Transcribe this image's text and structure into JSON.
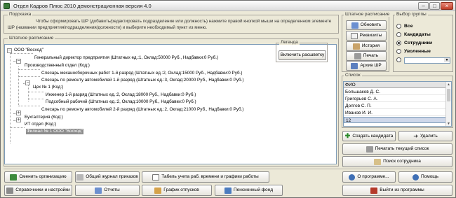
{
  "window": {
    "title": "Отдел Кадров Плюс 2010 демонстрационная версия 4.0",
    "minimize": "–",
    "maximize": "□",
    "close": "×"
  },
  "hint": {
    "legend": "Подсказка",
    "text": "Чтобы сформировать ШР (добавить/редактировать подразделение или должность) нажмите правой кнопкой мыши на определенном элементе ШР (названии предприятия/подразделения/должности) и выберите необходимый пункт из меню."
  },
  "staffing_tree": {
    "legend": "Штатное расписание",
    "nodes": [
      {
        "label": "ООО \"Восход\""
      },
      {
        "label": "Генеральный директор предприятия (Штатных ед.:1, Оклад:50000 Руб., Надбавки:0 Руб.)"
      },
      {
        "label": "Производственный отдел (Код:)"
      },
      {
        "label": "Слесарь механосборочных работ 1-й разряд (Штатных ед.:2, Оклад:15000 Руб., Надбавки:0 Руб.)"
      },
      {
        "label": "Слесарь по ремонту автомобилей 1-й разряд (Штатных ед.:3, Оклад:20000 Руб., Надбавки:0 Руб.)"
      },
      {
        "label": "Цех № 1 (Код:)"
      },
      {
        "label": "Инженер 1-й разряд (Штатных ед.:2, Оклад:18000 Руб., Надбавки:0 Руб.)"
      },
      {
        "label": "Подсобный рабочий (Штатных ед.:2, Оклад:10000 Руб., Надбавки:0 Руб.)"
      },
      {
        "label": "Слесарь по ремонту автомобилей 2-й разряд (Штатных ед.:2, Оклад:21000 Руб., Надбавки:0 Руб.)"
      },
      {
        "label": "Бухгалтерия (Код:)"
      },
      {
        "label": "ИТ отдел (Код:)"
      },
      {
        "label": "Филиал № 1 ООО \"Восход\""
      }
    ]
  },
  "legend_box": {
    "title": "Легенда",
    "button": "Включить расшветку"
  },
  "staff_panel": {
    "legend": "Штатное расписание",
    "buttons": [
      "Обновить",
      "Реквизиты",
      "История",
      "Печать",
      "Архив ШР"
    ]
  },
  "group_select": {
    "legend": "Выбор группы",
    "options": [
      "Все",
      "Кандидаты",
      "Сотрудники",
      "Уволенные"
    ],
    "selected": "Сотрудники"
  },
  "list": {
    "legend": "Список",
    "column": "ФИО",
    "rows": [
      "Большаков Д. С.",
      "Григорьев С. А.",
      "Долгов С. П.",
      "Иванов И. И.",
      "12"
    ]
  },
  "actions": {
    "create_candidate": "Создать кандидата",
    "delete": "Удалить",
    "print_list": "Печатать текущий список",
    "search": "Поиск сотрудника",
    "about": "О программе...",
    "help": "Помощь",
    "exit": "Выйти из программы"
  },
  "bottom_toolbar": {
    "change_org": "Сменить организацию",
    "orders_log": "Общий журнал приказов",
    "timesheet": "Табель учета раб. времени и графики работы",
    "references": "Справочники и настройки",
    "reports": "Отчеты",
    "vacations": "График отпусков",
    "pension": "Пенсионный фонд"
  },
  "colors": {
    "window_bg": "#ece9d8",
    "selection": "#8d8d8d",
    "border": "#7f9db9"
  }
}
